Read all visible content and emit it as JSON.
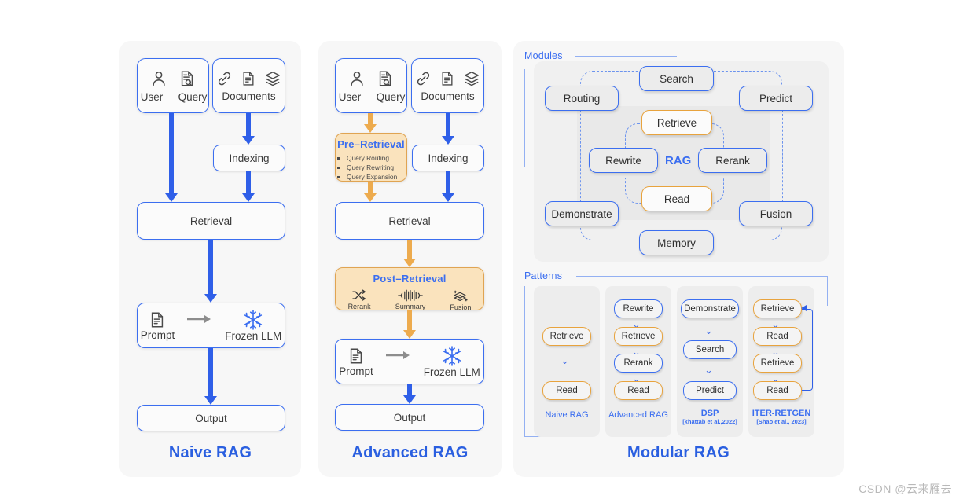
{
  "watermark": "CSDN @云来雁去",
  "naive": {
    "title": "Naive RAG",
    "user_query_box": {
      "icons": [
        "user-icon",
        "query-document-search-icon"
      ],
      "labels": [
        "User",
        "Query"
      ]
    },
    "documents_box": {
      "icons": [
        "link-icon",
        "document-icon",
        "layers-icon"
      ],
      "label": "Documents"
    },
    "indexing": "Indexing",
    "retrieval": "Retrieval",
    "prompt": "Prompt",
    "frozen_llm": "Frozen LLM",
    "output": "Output"
  },
  "advanced": {
    "title": "Advanced RAG",
    "user_query_box": {
      "icons": [
        "user-icon",
        "query-document-search-icon"
      ],
      "labels": [
        "User",
        "Query"
      ]
    },
    "documents_box": {
      "icons": [
        "link-icon",
        "document-icon",
        "layers-icon"
      ],
      "label": "Documents"
    },
    "pre_retrieval": {
      "title": "Pre–Retrieval",
      "items": [
        "Query Routing",
        "Query Rewriting",
        "Query Expansion"
      ]
    },
    "indexing": "Indexing",
    "retrieval": "Retrieval",
    "post_retrieval": {
      "title": "Post–Retrieval",
      "items": [
        "Rerank",
        "Summary",
        "Fusion"
      ]
    },
    "prompt": "Prompt",
    "frozen_llm": "Frozen LLM",
    "output": "Output"
  },
  "modular": {
    "title": "Modular RAG",
    "modules_label": "Modules",
    "patterns_label": "Patterns",
    "center_label": "RAG",
    "modules": {
      "search": "Search",
      "routing": "Routing",
      "predict": "Predict",
      "retrieve": "Retrieve",
      "rewrite": "Rewrite",
      "rerank": "Rerank",
      "read": "Read",
      "demonstrate": "Demonstrate",
      "fusion": "Fusion",
      "memory": "Memory"
    },
    "patterns": [
      {
        "name": "Naive RAG",
        "cite": "",
        "steps": [
          {
            "label": "Retrieve",
            "color": "orange"
          },
          {
            "label": "Read",
            "color": "orange"
          }
        ]
      },
      {
        "name": "Advanced RAG",
        "cite": "",
        "steps": [
          {
            "label": "Rewrite",
            "color": "blue"
          },
          {
            "label": "Retrieve",
            "color": "orange"
          },
          {
            "label": "Rerank",
            "color": "blue"
          },
          {
            "label": "Read",
            "color": "orange"
          }
        ]
      },
      {
        "name": "DSP",
        "cite": "[khattab et al.,2022]",
        "steps": [
          {
            "label": "Demonstrate",
            "color": "blue"
          },
          {
            "label": "Search",
            "color": "blue"
          },
          {
            "label": "Predict",
            "color": "blue"
          }
        ]
      },
      {
        "name": "ITER-RETGEN",
        "cite": "[Shao et al., 2023]",
        "steps": [
          {
            "label": "Retrieve",
            "color": "orange"
          },
          {
            "label": "Read",
            "color": "orange"
          },
          {
            "label": "Retrieve",
            "color": "orange"
          },
          {
            "label": "Read",
            "color": "orange"
          }
        ]
      }
    ]
  },
  "colors": {
    "accent_blue": "#3b6ef0",
    "arrow_blue": "#2f5fe8",
    "accent_orange": "#e8a33d",
    "arrow_orange": "#edab4e",
    "panel_bg": "#f7f7f7",
    "orange_fill": "#fae3bd"
  }
}
